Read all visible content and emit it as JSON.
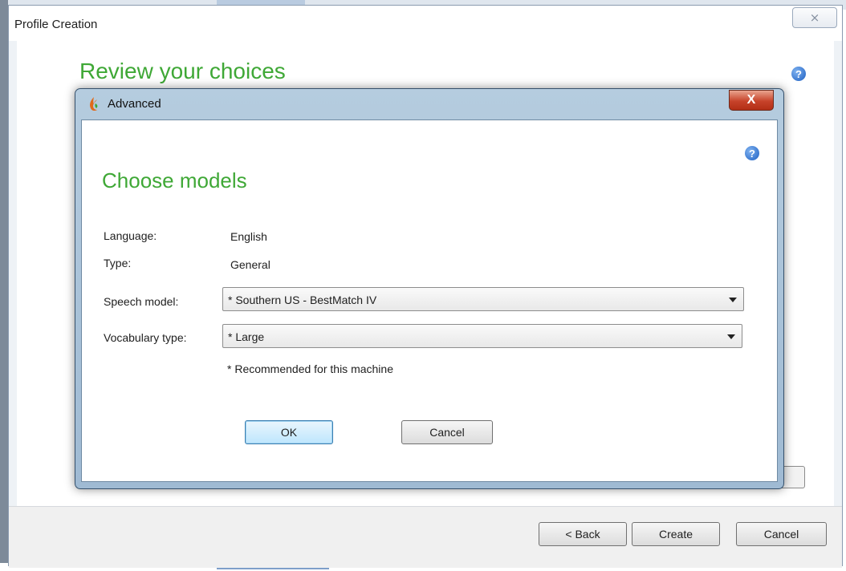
{
  "outer_window": {
    "title": "Profile Creation",
    "close_glyph": "⨯",
    "heading": "Review your choices",
    "help_glyph": "?",
    "footer": {
      "back_label": "< Back",
      "create_label": "Create",
      "cancel_label": "Cancel"
    }
  },
  "dialog": {
    "title": "Advanced",
    "close_glyph": "X",
    "help_glyph": "?",
    "heading": "Choose models",
    "fields": {
      "language_label": "Language:",
      "language_value": "English",
      "type_label": "Type:",
      "type_value": "General",
      "speech_model_label": "Speech model:",
      "speech_model_value": "* Southern US - BestMatch IV",
      "vocabulary_type_label": "Vocabulary type:",
      "vocabulary_type_value": "* Large"
    },
    "note": "* Recommended for this machine",
    "ok_label": "OK",
    "cancel_label": "Cancel"
  },
  "colors": {
    "heading_green": "#3fa836",
    "dialog_frame": "#a9c2d8",
    "close_red": "#c7432a"
  },
  "icons": {
    "app_icon": "dragon-flame-icon",
    "help_icon": "help-icon",
    "dropdown_icon": "chevron-down-icon"
  }
}
